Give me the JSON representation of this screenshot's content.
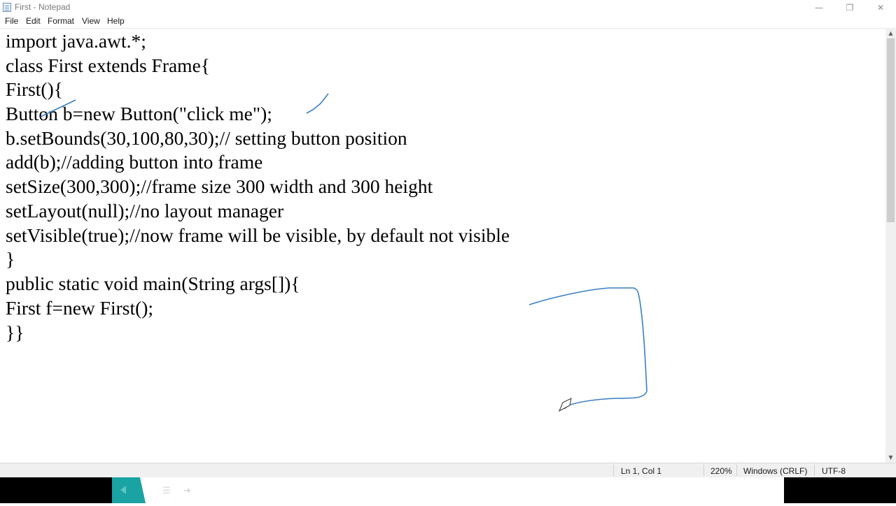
{
  "window": {
    "title": "First - Notepad",
    "minimize_glyph": "—",
    "restore_glyph": "❐",
    "close_glyph": "✕"
  },
  "menu": {
    "file": "File",
    "edit": "Edit",
    "format": "Format",
    "view": "View",
    "help": "Help"
  },
  "editor": {
    "lines": [
      "import java.awt.*;",
      "class First extends Frame{",
      "First(){",
      "Button b=new Button(\"click me\");",
      "b.setBounds(30,100,80,30);// setting button position",
      "add(b);//adding button into frame",
      "setSize(300,300);//frame size 300 width and 300 height",
      "setLayout(null);//no layout manager",
      "setVisible(true);//now frame will be visible, by default not visible",
      "}",
      "public static void main(String args[]){",
      "First f=new First();",
      "}}"
    ]
  },
  "status": {
    "position": "Ln 1, Col 1",
    "zoom": "220%",
    "line_ending": "Windows (CRLF)",
    "encoding": "UTF-8"
  },
  "colors": {
    "annotation_ink": "#3b7fc4",
    "taskbar_accent": "#1aa3a3"
  },
  "icons": {
    "app": "notepad-icon",
    "scroll_up": "chevron-up-icon",
    "scroll_down": "chevron-down-icon",
    "pen": "pen-icon"
  }
}
